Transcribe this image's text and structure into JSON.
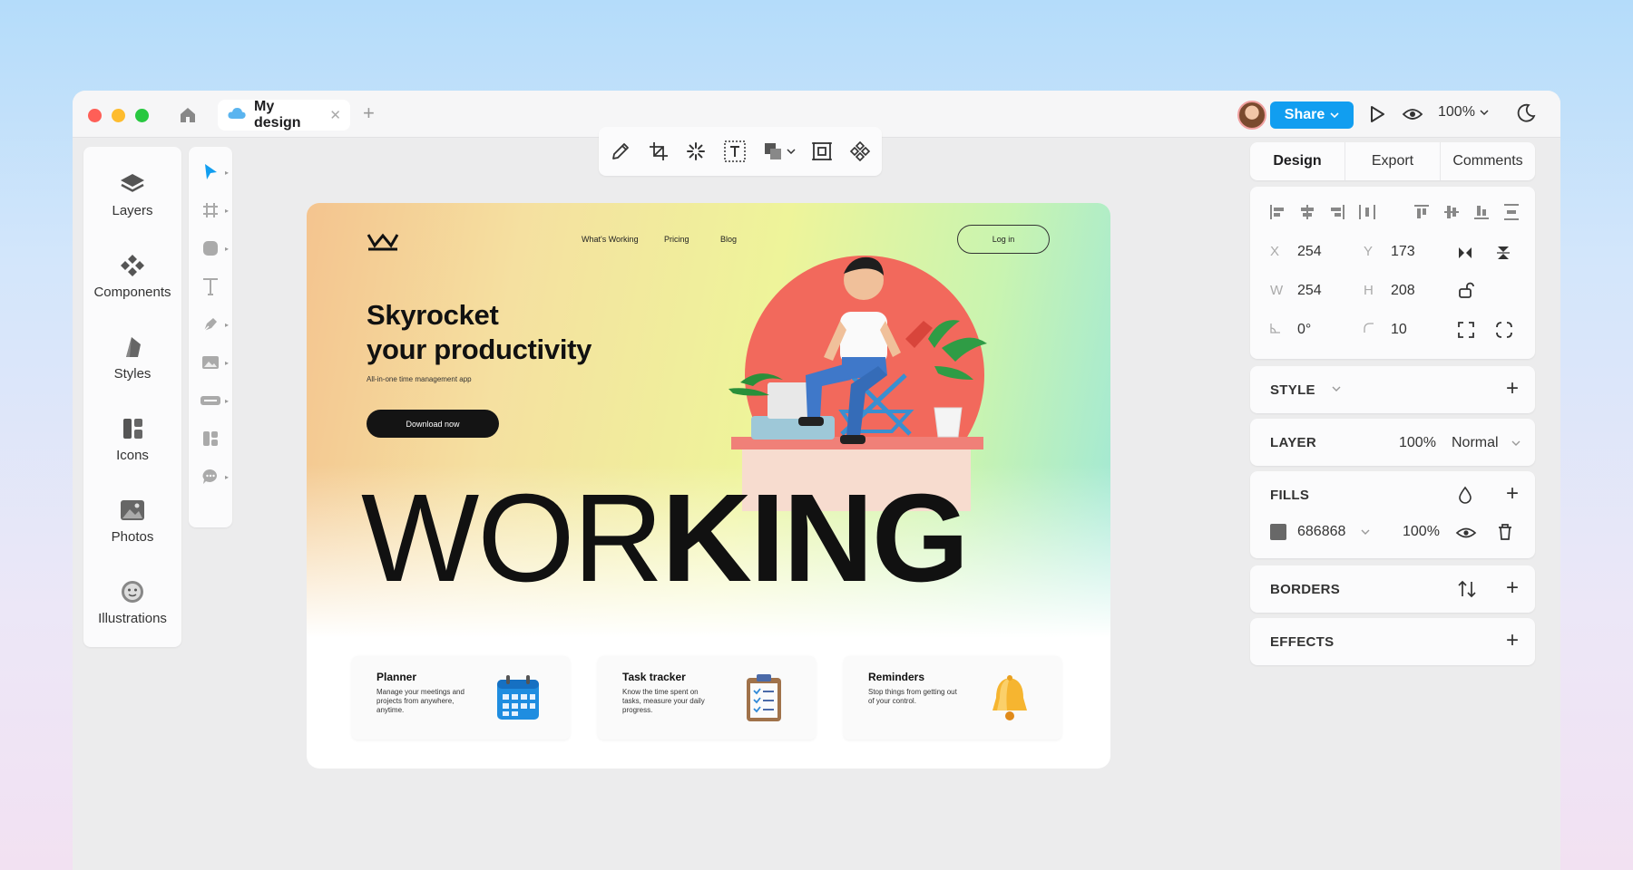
{
  "window": {
    "tab_title": "My design",
    "share_label": "Share",
    "zoom": "100%"
  },
  "assets": [
    {
      "label": "Layers",
      "icon": "layers-icon"
    },
    {
      "label": "Components",
      "icon": "components-icon"
    },
    {
      "label": "Styles",
      "icon": "styles-icon"
    },
    {
      "label": "Icons",
      "icon": "icons-icon"
    },
    {
      "label": "Photos",
      "icon": "photos-icon"
    },
    {
      "label": "Illustrations",
      "icon": "illustrations-icon"
    }
  ],
  "tools": [
    "pointer-tool-icon",
    "frame-tool-icon",
    "shape-tool-icon",
    "text-tool-icon",
    "pen-tool-icon",
    "image-tool-icon",
    "input-tool-icon",
    "component-tool-icon",
    "comment-tool-icon"
  ],
  "top_toolbar": [
    "pencil-icon",
    "crop-icon",
    "loader-icon",
    "text-box-icon",
    "boolean-icon",
    "frame-select-icon",
    "component-icon"
  ],
  "canvas": {
    "nav": [
      "What's Working",
      "Pricing",
      "Blog"
    ],
    "login": "Log in",
    "headline_line1": "Skyrocket",
    "headline_line2": "your productivity",
    "tagline": "All-in-one time management app",
    "cta": "Download now",
    "big_word_thin": "WOR",
    "big_word_bold": "KING",
    "features": [
      {
        "title": "Planner",
        "desc": "Manage your meetings and projects from anywhere, anytime."
      },
      {
        "title": "Task tracker",
        "desc": "Know the time spent on tasks, measure your daily progress."
      },
      {
        "title": "Reminders",
        "desc": "Stop things from getting out of your control."
      }
    ]
  },
  "properties": {
    "tabs": [
      "Design",
      "Export",
      "Comments"
    ],
    "x": "254",
    "y": "173",
    "w": "254",
    "h": "208",
    "rotation": "0°",
    "radius": "10",
    "labels": {
      "x": "X",
      "y": "Y",
      "w": "W",
      "h": "H"
    },
    "style_title": "STYLE",
    "layer_title": "LAYER",
    "layer_opacity": "100%",
    "blend_mode": "Normal",
    "fills_title": "FILLS",
    "fill_hex": "686868",
    "fill_opacity": "100%",
    "borders_title": "BORDERS",
    "effects_title": "EFFECTS"
  },
  "colors": {
    "accent": "#119ef0",
    "fill_swatch": "#686868"
  }
}
